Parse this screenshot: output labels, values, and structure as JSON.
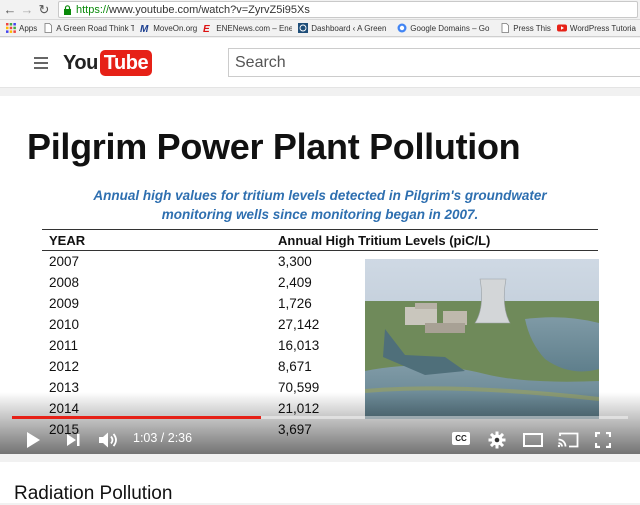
{
  "browser": {
    "url_scheme": "https://",
    "url_rest": "www.youtube.com/watch?v=ZyrvZ5i95Xs"
  },
  "bookmarks": [
    {
      "label": "Apps",
      "icon": "apps-grid-icon"
    },
    {
      "label": "A Green Road Think T",
      "icon": "page-icon"
    },
    {
      "label": "MoveOn.org",
      "icon": "moveon-icon"
    },
    {
      "label": "ENENews.com – Ener",
      "icon": "enenews-icon"
    },
    {
      "label": "Dashboard ‹ A Green",
      "icon": "wordpress-icon"
    },
    {
      "label": "Google Domains – Go",
      "icon": "google-icon"
    },
    {
      "label": "Press This",
      "icon": "page-icon"
    },
    {
      "label": "WordPress Tutoria",
      "icon": "youtube-icon"
    }
  ],
  "youtube": {
    "logo_you": "You",
    "logo_tube": "Tube",
    "search_placeholder": "Search"
  },
  "slide": {
    "title": "Pilgrim Power Plant Pollution",
    "subtitle_line1": "Annual high values for tritium levels detected in Pilgrim's groundwater",
    "subtitle_line2": "monitoring wells since monitoring began in 2007.",
    "col_year": "YEAR",
    "col_level": "Annual High Tritium Levels (piC/L)",
    "rows": [
      {
        "year": "2007",
        "level": "3,300"
      },
      {
        "year": "2008",
        "level": "2,409"
      },
      {
        "year": "2009",
        "level": "1,726"
      },
      {
        "year": "2010",
        "level": "27,142"
      },
      {
        "year": "2011",
        "level": "16,013"
      },
      {
        "year": "2012",
        "level": "8,671"
      },
      {
        "year": "2013",
        "level": "70,599"
      },
      {
        "year": "2014",
        "level": "21,012"
      },
      {
        "year": "2015",
        "level": "3,697"
      }
    ]
  },
  "player": {
    "time": "1:03 / 2:36",
    "progress_fraction": 0.4038,
    "cc_label": "CC",
    "accent": "#e62117"
  },
  "video_title": "Radiation Pollution"
}
